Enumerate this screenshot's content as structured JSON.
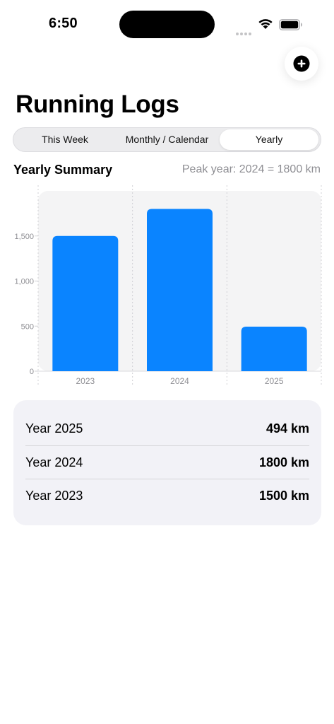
{
  "status_bar": {
    "time": "6:50"
  },
  "header": {
    "title": "Running Logs"
  },
  "tabs": [
    {
      "label": "This Week",
      "active": false
    },
    {
      "label": "Monthly / Calendar",
      "active": false
    },
    {
      "label": "Yearly",
      "active": true
    }
  ],
  "summary": {
    "title": "Yearly Summary",
    "peak_text": "Peak year: 2024 = 1800 km"
  },
  "chart_data": {
    "type": "bar",
    "categories": [
      "2023",
      "2024",
      "2025"
    ],
    "values": [
      1500,
      1800,
      494
    ],
    "ylim": [
      0,
      2000
    ],
    "yticks": [
      0,
      500,
      1000,
      1500
    ],
    "ytick_labels": [
      "0",
      "500",
      "1,000",
      "1,500"
    ],
    "bar_color": "#0a84ff",
    "grid": false
  },
  "year_list": [
    {
      "label": "Year 2025",
      "value": "494 km"
    },
    {
      "label": "Year 2024",
      "value": "1800 km"
    },
    {
      "label": "Year 2023",
      "value": "1500 km"
    }
  ],
  "colors": {
    "accent": "#0a84ff",
    "card_bg": "#f2f2f7",
    "secondary_text": "#8e8e93"
  },
  "icons": {
    "add": "plus-circle-icon",
    "wifi": "wifi-icon",
    "battery": "battery-icon"
  }
}
